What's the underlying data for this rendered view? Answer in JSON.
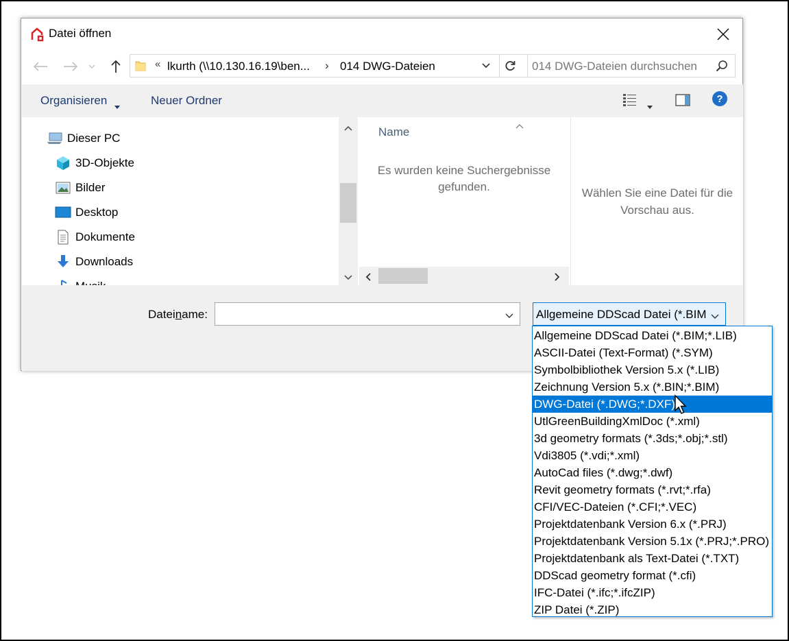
{
  "dialog": {
    "title": "Datei öffnen"
  },
  "navbar": {
    "address_overflow": "«",
    "address_segments": [
      "lkurth (\\\\10.130.16.19\\ben...",
      "014 DWG-Dateien"
    ],
    "address_separator": "›",
    "search_placeholder": "014 DWG-Dateien durchsuchen"
  },
  "toolbar": {
    "organize_label": "Organisieren",
    "new_folder_label": "Neuer Ordner"
  },
  "nav_pane": {
    "items": [
      {
        "label": "Dieser PC",
        "icon": "this-pc-icon"
      },
      {
        "label": "3D-Objekte",
        "icon": "3d-objects-icon"
      },
      {
        "label": "Bilder",
        "icon": "pictures-icon"
      },
      {
        "label": "Desktop",
        "icon": "desktop-icon"
      },
      {
        "label": "Dokumente",
        "icon": "documents-icon"
      },
      {
        "label": "Downloads",
        "icon": "downloads-icon"
      },
      {
        "label": "Musik",
        "icon": "music-icon"
      }
    ]
  },
  "file_pane": {
    "column_name": "Name",
    "empty_message": "Es wurden keine Suchergebnisse gefunden."
  },
  "preview_pane": {
    "message": "Wählen Sie eine Datei für die Vorschau aus."
  },
  "bottom": {
    "filename_label": "Dateiname:",
    "filename_value": "",
    "filter_selected": "Allgemeine DDScad Datei (*.BIM;*.LIB)"
  },
  "filter_options": [
    "Allgemeine DDScad Datei (*.BIM;*.LIB)",
    "ASCII-Datei (Text-Format) (*.SYM)",
    "Symbolbibliothek Version 5.x  (*.LIB)",
    "Zeichnung Version 5.x (*.BIN;*.BIM)",
    "DWG-Datei (*.DWG;*.DXF)",
    "UtlGreenBuildingXmlDoc (*.xml)",
    "3d geometry formats (*.3ds;*.obj;*.stl)",
    "Vdi3805 (*.vdi;*.xml)",
    "AutoCad files (*.dwg;*.dwf)",
    "Revit geometry formats (*.rvt;*.rfa)",
    "CFI/VEC-Dateien (*.CFI;*.VEC)",
    "Projektdatenbank Version 6.x (*.PRJ)",
    "Projektdatenbank Version 5.1x (*.PRJ;*.PRO)",
    "Projektdatenbank als Text-Datei (*.TXT)",
    "DDScad geometry format (*.cfi)",
    "IFC-Datei (*.ifc;*.ifcZIP)",
    "ZIP Datei (*.ZIP)"
  ],
  "highlighted_option": "DWG-Datei (*.DWG;*.DXF)",
  "colors": {
    "accent": "#0078d7",
    "toolbar_bg": "#f0f0f0",
    "link_text": "#1e3a6e"
  }
}
